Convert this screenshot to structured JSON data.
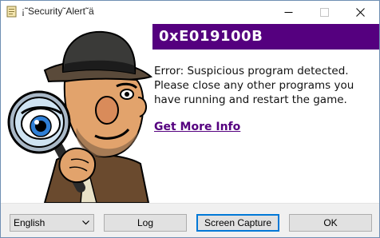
{
  "window": {
    "title": "¡˜Security˜Alert˜ä"
  },
  "error": {
    "code": "0xE019100B",
    "message_lines": [
      "Error: Suspicious program detected.",
      "Please close any other programs you",
      "have running and restart the game."
    ],
    "more_info_link": "Get More Info"
  },
  "footer": {
    "language_selected": "English",
    "log_label": "Log",
    "capture_label": "Screen Capture",
    "ok_label": "OK"
  },
  "colors": {
    "accent": "#55007f",
    "accent_text": "#ffffff"
  },
  "icons": {
    "app": "app-icon",
    "minimize": "minimize-icon",
    "maximize": "maximize-icon",
    "close": "close-icon",
    "dropdown": "chevron-down-icon"
  }
}
